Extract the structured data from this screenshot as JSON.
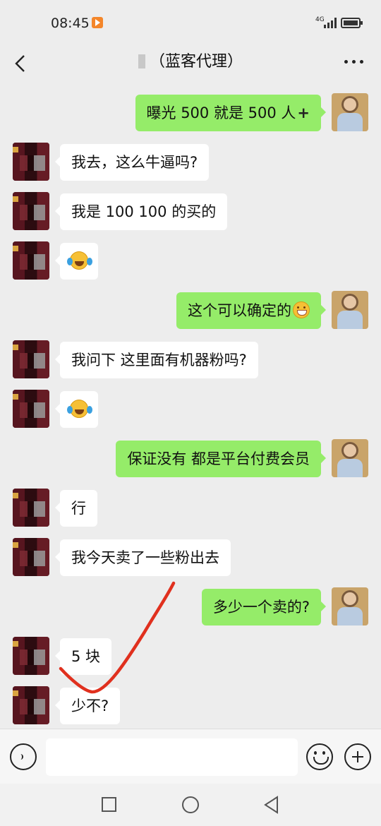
{
  "status_bar": {
    "time": "08:45",
    "network": "4G",
    "app_notification_icon": "play-badge-icon",
    "battery_icon": "battery-charging-icon"
  },
  "header": {
    "title": "（蓝客代理）",
    "back_icon": "chevron-left-icon",
    "more_icon": "more-dots-icon"
  },
  "messages": [
    {
      "side": "right",
      "text": "曝光 500 就是 500 人",
      "suffix": "+"
    },
    {
      "side": "left",
      "text": "我去，这么牛逼吗?"
    },
    {
      "side": "left",
      "text": "我是 100 100 的买的"
    },
    {
      "side": "left",
      "emoji": "laugh-cry-emoji"
    },
    {
      "side": "right",
      "text": "这个可以确定的",
      "emoji": "grin-emoji"
    },
    {
      "side": "left",
      "text": "我问下 这里面有机器粉吗?"
    },
    {
      "side": "left",
      "emoji": "laugh-cry-emoji"
    },
    {
      "side": "right",
      "text": "保证没有 都是平台付费会员"
    },
    {
      "side": "left",
      "text": "行"
    },
    {
      "side": "left",
      "text": "我今天卖了一些粉出去"
    },
    {
      "side": "right",
      "text": "多少一个卖的?"
    },
    {
      "side": "left",
      "text": "5 块"
    },
    {
      "side": "left",
      "text": "少不?"
    }
  ],
  "input_bar": {
    "placeholder": "",
    "voice_icon": "voice-icon",
    "emoji_icon": "emoji-icon",
    "plus_icon": "plus-circle-icon"
  },
  "system_nav": {
    "recent_icon": "recent-apps-icon",
    "home_icon": "home-icon",
    "back_icon": "back-triangle-icon"
  },
  "colors": {
    "background": "#ededed",
    "outgoing_bubble": "#95ec69",
    "incoming_bubble": "#ffffff",
    "annotation_stroke": "#e0301e"
  }
}
